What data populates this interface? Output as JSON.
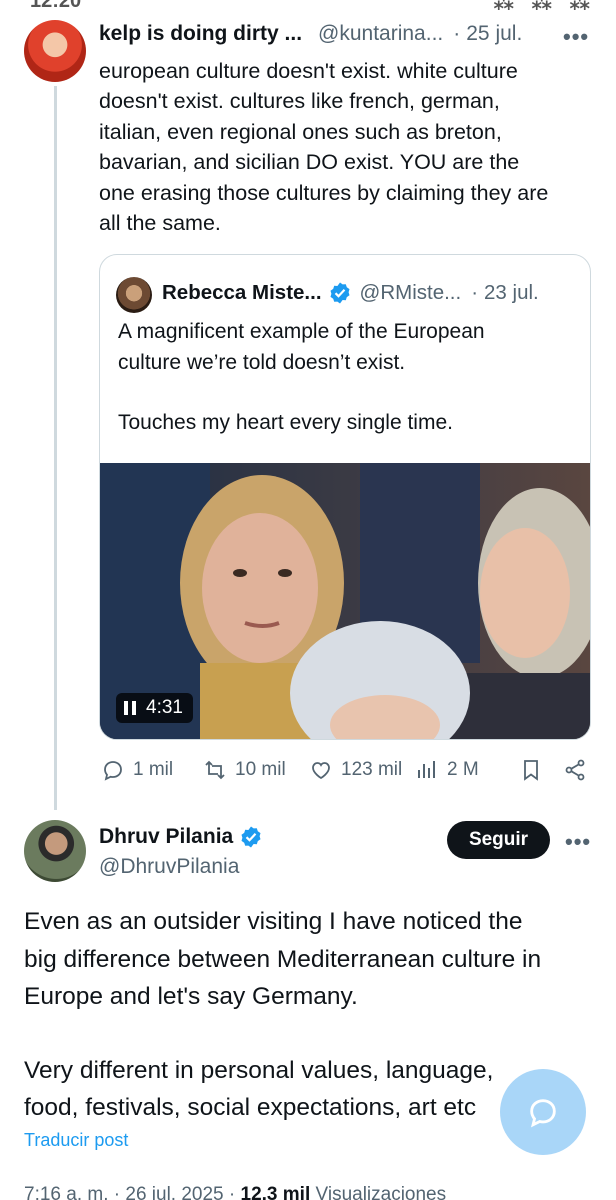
{
  "status_bar": {
    "left": "12:20",
    "right": "⁂ ⁂ ⁂"
  },
  "reply": {
    "name": "kelp is doing dirty ...",
    "handle": "@kuntarina...",
    "date": "25 jul.",
    "more": "•••",
    "text_lines": [
      "european culture doesn't exist. white culture",
      "doesn't exist. cultures like french, german,",
      "italian, even regional ones such as breton,",
      "bavarian, and sicilian DO  exist. YOU are the",
      "one erasing those cultures by claiming they are",
      "all the same."
    ]
  },
  "quote": {
    "name": "Rebecca Miste...",
    "handle": "@RMiste...",
    "date": "23 jul.",
    "text_line1": "A magnificent example of the European",
    "text_line2": "culture we’re told doesn’t exist.",
    "text_line3": "Touches my heart every single time.",
    "video_duration": "4:31"
  },
  "actions": {
    "replies": "1 mil",
    "reposts": "10 mil",
    "likes": "123 mil",
    "views": "2 M"
  },
  "main": {
    "name": "Dhruv Pilania",
    "handle": "@DhruvPilania",
    "follow_label": "Seguir",
    "more": "•••",
    "text_lines": [
      "Even as an outsider visiting I have noticed the",
      "big difference between Mediterranean culture in",
      "Europe and let's say Germany."
    ],
    "text_lines2": [
      "Very different in personal values, language,",
      "food, festivals, social expectations, art etc"
    ],
    "translate_label": "Traducir post",
    "timestamp": "7:16 a. m. · 26 jul. 2025 · ",
    "views_count": "12,3 mil",
    "views_label": " Visualizaciones"
  },
  "colors": {
    "accent": "#1d9bf0",
    "text": "#0f1419",
    "secondary": "#536471",
    "border": "#cfd9de"
  }
}
